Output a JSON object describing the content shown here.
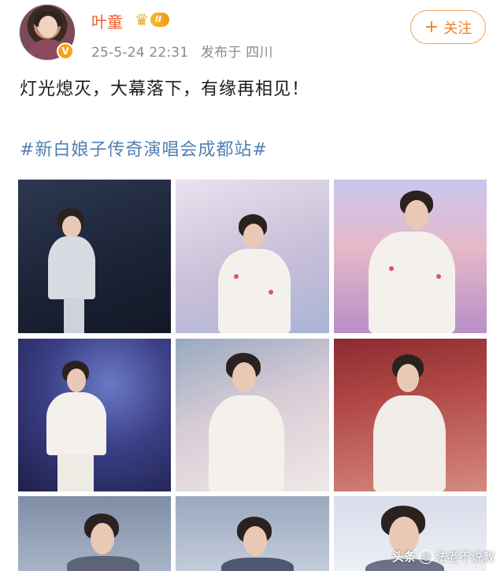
{
  "user": {
    "name": "叶童",
    "vip_level": "II",
    "verified_mark": "V",
    "time": "25-5-24 22:31",
    "location": "发布于 四川"
  },
  "follow_button": {
    "label": "关注",
    "icon": "plus-icon"
  },
  "post": {
    "text": "灯光熄灭，大幕落下，有缘再相见！",
    "hashtag": "#新白娘子传奇演唱会成都站#"
  },
  "photos": [
    {
      "id": "photo-1"
    },
    {
      "id": "photo-2"
    },
    {
      "id": "photo-3"
    },
    {
      "id": "photo-4"
    },
    {
      "id": "photo-5"
    },
    {
      "id": "photo-6"
    },
    {
      "id": "photo-7"
    },
    {
      "id": "photo-8"
    },
    {
      "id": "photo-9"
    }
  ],
  "watermark": {
    "brand": "头条",
    "author": "法老不说教"
  },
  "colors": {
    "username": "#f05e2c",
    "hashtag": "#4f7fb5",
    "follow_border": "#f2a35a",
    "meta": "#8a8a8a"
  }
}
